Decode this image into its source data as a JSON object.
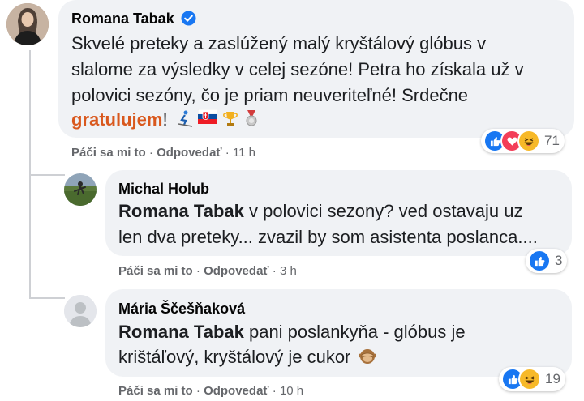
{
  "comments": [
    {
      "author": "Romana Tabak",
      "verified": true,
      "lines": [
        "Skvelé preteky a zaslúžený malý kryštálový glóbus v",
        "slalome za výsledky v celej sezóne! Petra ho získala už v",
        "polovici sezóny, čo je priam neuveriteľné! Srdečne"
      ],
      "last_line_tag": "gratulujem",
      "last_line_rest": "!",
      "like": "Páči sa mi to",
      "sep": "·",
      "reply": "Odpovedať",
      "time": "11 h",
      "reaction_count": "71",
      "reactions": [
        "like-icon",
        "love-icon",
        "haha-icon"
      ]
    },
    {
      "author": "Michal Holub",
      "mention": "Romana Tabak",
      "line1_rest": " v polovici sezony? ved ostavaju uz",
      "line2": "len dva preteky... zvazil by som asistenta poslanca....",
      "like": "Páči sa mi to",
      "sep": "·",
      "reply": "Odpovedať",
      "time": "3 h",
      "reaction_count": "3",
      "reactions": [
        "like-icon"
      ]
    },
    {
      "author": "Mária Ščešňaková",
      "mention": "Romana Tabak",
      "line1_rest": " pani poslankyňa - glóbus je",
      "line2": "krištáľový, kryštálový je cukor",
      "like": "Páči sa mi to",
      "sep": "·",
      "reply": "Odpovedať",
      "time": "10 h",
      "reaction_count": "19",
      "reactions": [
        "like-icon",
        "haha-icon"
      ]
    }
  ],
  "colors": {
    "bubble": "#f0f2f5",
    "like_blue": "#1877f2",
    "love_red": "#f33e58",
    "haha_yellow": "#f7b928",
    "tag": "#d9581d"
  }
}
